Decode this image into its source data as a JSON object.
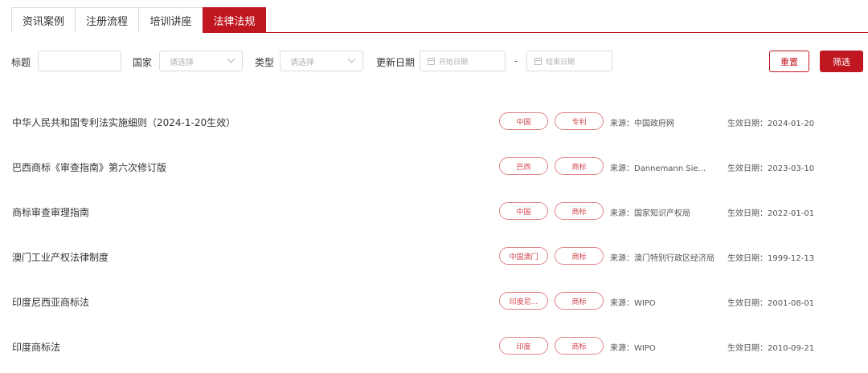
{
  "tabs": [
    {
      "label": "资讯案例",
      "active": false
    },
    {
      "label": "注册流程",
      "active": false
    },
    {
      "label": "培训讲座",
      "active": false
    },
    {
      "label": "法律法规",
      "active": true
    }
  ],
  "filters": {
    "title_label": "标题",
    "title_value": "",
    "country_label": "国家",
    "country_placeholder": "请选择",
    "type_label": "类型",
    "type_placeholder": "请选择",
    "date_label": "更新日期",
    "start_placeholder": "开始日期",
    "separator": "-",
    "end_placeholder": "结束日期",
    "reset_label": "重置",
    "filter_label": "筛选"
  },
  "items": [
    {
      "title": "中华人民共和国专利法实施细则（2024-1-20生效）",
      "country": "中国",
      "type": "专利",
      "source": "来源：中国政府网",
      "effective": "生效日期：2024-01-20"
    },
    {
      "title": "巴西商标《审查指南》第六次修订版",
      "country": "巴西",
      "type": "商标",
      "source": "来源：Dannemann Sie...",
      "effective": "生效日期：2023-03-10"
    },
    {
      "title": "商标审查审理指南",
      "country": "中国",
      "type": "商标",
      "source": "来源：国家知识产权局",
      "effective": "生效日期：2022-01-01"
    },
    {
      "title": "澳门工业产权法律制度",
      "country": "中国澳门",
      "type": "商标",
      "source": "来源：澳门特别行政区经济局",
      "effective": "生效日期：1999-12-13"
    },
    {
      "title": "印度尼西亚商标法",
      "country": "印度尼...",
      "type": "商标",
      "source": "来源：WIPO",
      "effective": "生效日期：2001-08-01"
    },
    {
      "title": "印度商标法",
      "country": "印度",
      "type": "商标",
      "source": "来源：WIPO",
      "effective": "生效日期：2010-09-21"
    }
  ],
  "colors": {
    "accent": "#c0161f"
  }
}
